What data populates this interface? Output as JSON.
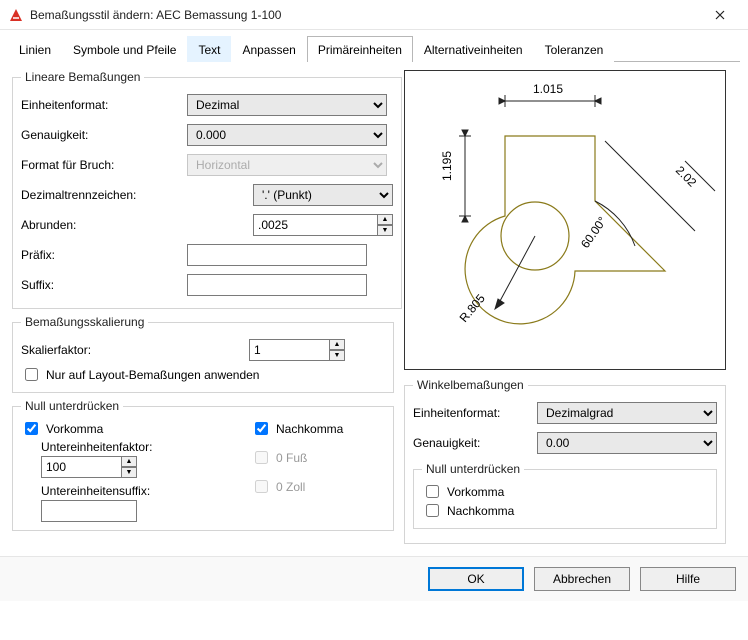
{
  "window": {
    "title": "Bemaßungsstil ändern: AEC Bemassung 1-100"
  },
  "tabs": {
    "t0": "Linien",
    "t1": "Symbole und Pfeile",
    "t2": "Text",
    "t3": "Anpassen",
    "t4": "Primäreinheiten",
    "t5": "Alternativeinheiten",
    "t6": "Toleranzen"
  },
  "linear": {
    "legend": "Lineare Bemaßungen",
    "unitformat_lbl": "Einheitenformat:",
    "unitformat": "Dezimal",
    "precision_lbl": "Genauigkeit:",
    "precision": "0.000",
    "fraction_lbl": "Format für Bruch:",
    "fraction": "Horizontal",
    "decsep_lbl": "Dezimaltrennzeichen:",
    "decsep": "'.' (Punkt)",
    "round_lbl": "Abrunden:",
    "round": ".0025",
    "prefix_lbl": "Präfix:",
    "prefix": "",
    "suffix_lbl": "Suffix:",
    "suffix": ""
  },
  "scale": {
    "legend": "Bemaßungsskalierung",
    "factor_lbl": "Skalierfaktor:",
    "factor": "1",
    "layout_only": "Nur auf Layout-Bemaßungen anwenden"
  },
  "zero": {
    "legend": "Null unterdrücken",
    "leading": "Vorkomma",
    "trailing": "Nachkomma",
    "subfactor_lbl": "Untereinheitenfaktor:",
    "subfactor": "100",
    "subsuffix_lbl": "Untereinheitensuffix:",
    "subsuffix": "",
    "feet": "0 Fuß",
    "inch": "0 Zoll"
  },
  "angular": {
    "legend": "Winkelbemaßungen",
    "unitformat_lbl": "Einheitenformat:",
    "unitformat": "Dezimalgrad",
    "precision_lbl": "Genauigkeit:",
    "precision": "0.00",
    "zero_legend": "Null unterdrücken",
    "leading": "Vorkomma",
    "trailing": "Nachkomma"
  },
  "preview": {
    "d1": "1.015",
    "d2": "1.195",
    "d3": "R.805",
    "d4": "60.00°",
    "d5": "2.02"
  },
  "footer": {
    "ok": "OK",
    "cancel": "Abbrechen",
    "help": "Hilfe"
  }
}
